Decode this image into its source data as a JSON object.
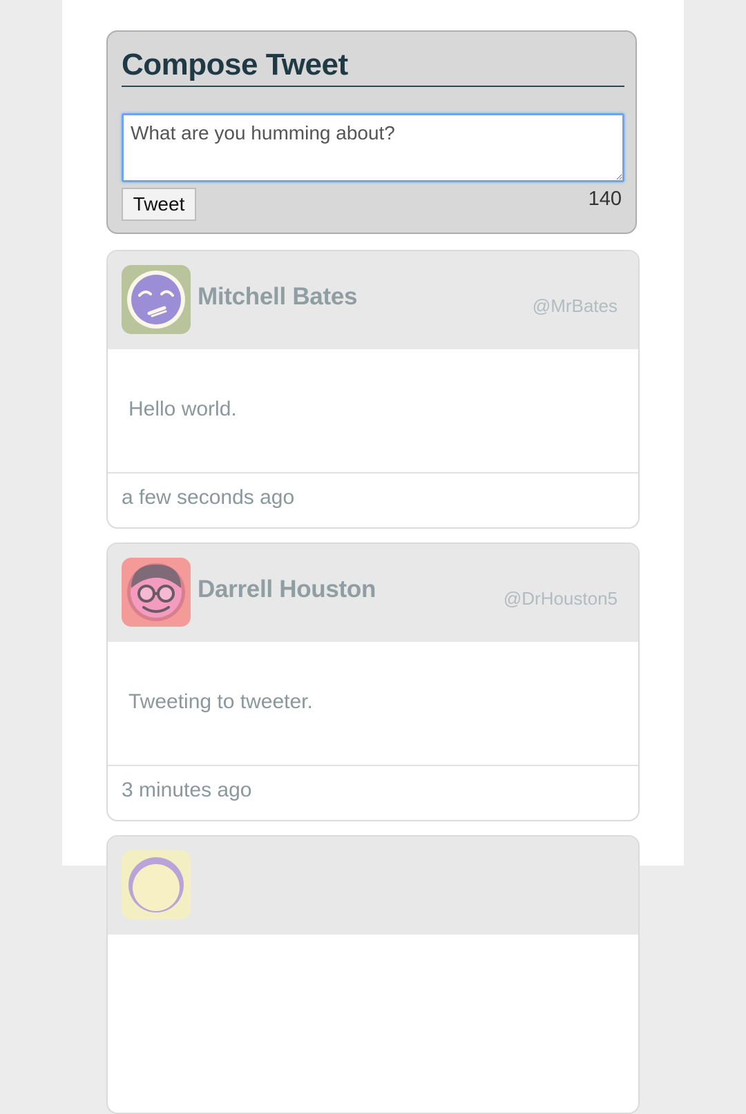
{
  "compose": {
    "title": "Compose Tweet",
    "placeholder": "What are you humming about?",
    "button_label": "Tweet",
    "char_count": "140"
  },
  "tweets": [
    {
      "name": "Mitchell Bates",
      "handle": "@MrBates",
      "text": "Hello world.",
      "time": "a few seconds ago",
      "avatar_icon": "smiling-face-icon",
      "avatar_bg": "#b9c49c",
      "avatar_face": "#9b8ed6"
    },
    {
      "name": "Darrell Houston",
      "handle": "@DrHouston5",
      "text": "Tweeting to tweeter.",
      "time": "3 minutes ago",
      "avatar_icon": "glasses-face-icon",
      "avatar_bg": "#f49a98",
      "avatar_face": "#d97e8c"
    },
    {
      "avatar_icon": "face-icon",
      "avatar_bg": "#f3efc2",
      "avatar_face": "#b9a3d8"
    }
  ]
}
